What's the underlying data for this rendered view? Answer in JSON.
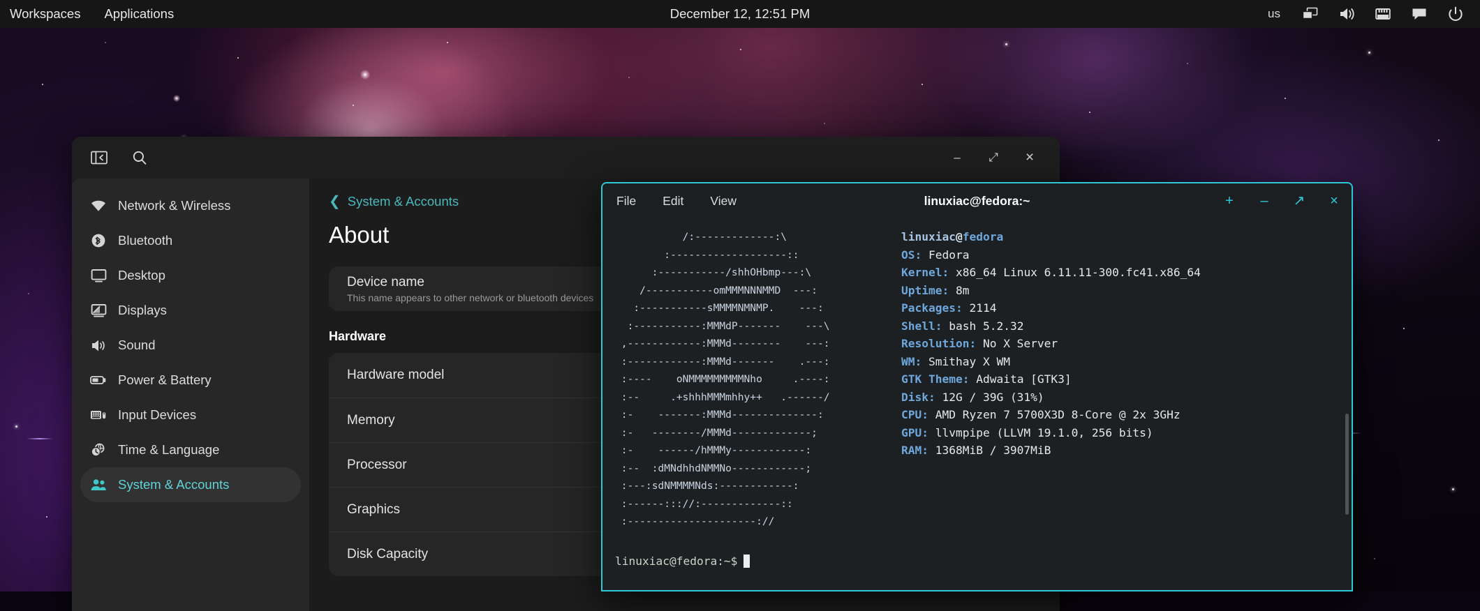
{
  "topbar": {
    "workspaces_label": "Workspaces",
    "applications_label": "Applications",
    "clock": "December 12, 12:51 PM",
    "keyboard_layout": "us",
    "tray_icons": [
      "display-switch-icon",
      "volume-icon",
      "network-wired-icon",
      "notification-icon",
      "power-icon"
    ]
  },
  "settings_window": {
    "header": {
      "sidebar_toggle_icon": "sidebar-toggle-icon",
      "search_icon": "search-icon",
      "minimize_label": "–",
      "maximize_label": "⤢",
      "close_label": "×"
    },
    "sidebar": {
      "items": [
        {
          "label": "Network & Wireless",
          "icon": "wifi-icon",
          "active": false
        },
        {
          "label": "Bluetooth",
          "icon": "bluetooth-icon",
          "active": false
        },
        {
          "label": "Desktop",
          "icon": "monitor-icon",
          "active": false
        },
        {
          "label": "Displays",
          "icon": "displays-icon",
          "active": false
        },
        {
          "label": "Sound",
          "icon": "speaker-icon",
          "active": false
        },
        {
          "label": "Power & Battery",
          "icon": "battery-icon",
          "active": false
        },
        {
          "label": "Input Devices",
          "icon": "keyboard-mouse-icon",
          "active": false
        },
        {
          "label": "Time & Language",
          "icon": "clock-globe-icon",
          "active": false
        },
        {
          "label": "System & Accounts",
          "icon": "users-icon",
          "active": true
        }
      ]
    },
    "content": {
      "breadcrumb": "System & Accounts",
      "breadcrumb_back_icon": "chevron-left-icon",
      "title": "About",
      "device_name": {
        "label": "Device name",
        "description": "This name appears to other network or bluetooth devices"
      },
      "hardware_section": "Hardware",
      "hardware_rows": [
        {
          "label": "Hardware model"
        },
        {
          "label": "Memory"
        },
        {
          "label": "Processor"
        },
        {
          "label": "Graphics"
        },
        {
          "label": "Disk Capacity"
        }
      ]
    }
  },
  "terminal_window": {
    "menus": [
      "File",
      "Edit",
      "View"
    ],
    "title": "linuxiac@fedora:~",
    "buttons": {
      "new_tab": "+",
      "minimize": "–",
      "maximize": "↗",
      "close": "×"
    },
    "accent_color": "#2ec9d6",
    "ascii_art": "           /:-------------:\\\n        :-------------------::\n      :-----------/shhOHbmp---:\\\n    /-----------omMMMNNNMMD  ---:\n   :-----------sMMMMNMNMP.    ---:\n  :-----------:MMMdP-------    ---\\\n ,------------:MMMd--------    ---:\n :------------:MMMd-------    .---:\n :----    oNMMMMMMMMMNho     .----:\n :--     .+shhhMMMmhhy++   .------/\n :-    -------:MMMd--------------:\n :-   --------/MMMd-------------;\n :-    ------/hMMMy------------:\n :--  :dMNdhhdNMMNo------------;\n :---:sdNMMMMNds:------------:\n :------::://:-------------::\n :---------------------://",
    "info": {
      "host_user": "linuxiac",
      "host_at": "@",
      "host_name": "fedora",
      "fields": [
        {
          "key": "OS:",
          "value": "Fedora"
        },
        {
          "key": "Kernel:",
          "value": "x86_64 Linux 6.11.11-300.fc41.x86_64"
        },
        {
          "key": "Uptime:",
          "value": "8m"
        },
        {
          "key": "Packages:",
          "value": "2114"
        },
        {
          "key": "Shell:",
          "value": "bash 5.2.32"
        },
        {
          "key": "Resolution:",
          "value": "No X Server"
        },
        {
          "key": "WM:",
          "value": "Smithay X WM"
        },
        {
          "key": "GTK Theme:",
          "value": "Adwaita [GTK3]"
        },
        {
          "key": "Disk:",
          "value": "12G / 39G (31%)"
        },
        {
          "key": "CPU:",
          "value": "AMD Ryzen 7 5700X3D 8-Core @ 2x 3GHz"
        },
        {
          "key": "GPU:",
          "value": "llvmpipe (LLVM 19.1.0, 256 bits)"
        },
        {
          "key": "RAM:",
          "value": "1368MiB / 3907MiB"
        }
      ]
    },
    "prompt": "linuxiac@fedora:~$"
  }
}
